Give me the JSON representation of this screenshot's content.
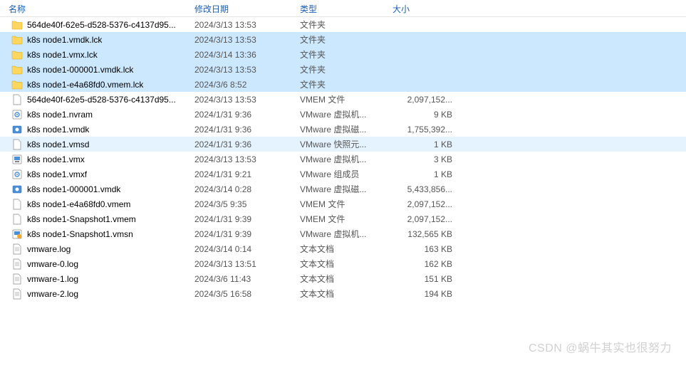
{
  "columns": {
    "name": "名称",
    "date": "修改日期",
    "type": "类型",
    "size": "大小"
  },
  "files": [
    {
      "icon": "folder",
      "name": "564de40f-62e5-d528-5376-c4137d95...",
      "date": "2024/3/13 13:53",
      "type": "文件夹",
      "size": "",
      "highlight": false
    },
    {
      "icon": "folder",
      "name": "k8s node1.vmdk.lck",
      "date": "2024/3/13 13:53",
      "type": "文件夹",
      "size": "",
      "highlight": true
    },
    {
      "icon": "folder",
      "name": "k8s node1.vmx.lck",
      "date": "2024/3/14 13:36",
      "type": "文件夹",
      "size": "",
      "highlight": true
    },
    {
      "icon": "folder",
      "name": "k8s node1-000001.vmdk.lck",
      "date": "2024/3/13 13:53",
      "type": "文件夹",
      "size": "",
      "highlight": true
    },
    {
      "icon": "folder",
      "name": "k8s node1-e4a68fd0.vmem.lck",
      "date": "2024/3/6 8:52",
      "type": "文件夹",
      "size": "",
      "highlight": true
    },
    {
      "icon": "file",
      "name": "564de40f-62e5-d528-5376-c4137d95...",
      "date": "2024/3/13 13:53",
      "type": "VMEM 文件",
      "size": "2,097,152...",
      "highlight": false
    },
    {
      "icon": "gear",
      "name": "k8s node1.nvram",
      "date": "2024/1/31 9:36",
      "type": "VMware 虚拟机...",
      "size": "9 KB",
      "highlight": false
    },
    {
      "icon": "disk",
      "name": "k8s node1.vmdk",
      "date": "2024/1/31 9:36",
      "type": "VMware 虚拟磁...",
      "size": "1,755,392...",
      "highlight": false
    },
    {
      "icon": "file",
      "name": "k8s node1.vmsd",
      "date": "2024/1/31 9:36",
      "type": "VMware 快照元...",
      "size": "1 KB",
      "highlight": false,
      "hover": true
    },
    {
      "icon": "vmx",
      "name": "k8s node1.vmx",
      "date": "2024/3/13 13:53",
      "type": "VMware 虚拟机...",
      "size": "3 KB",
      "highlight": false
    },
    {
      "icon": "gear",
      "name": "k8s node1.vmxf",
      "date": "2024/1/31 9:21",
      "type": "VMware 组成员",
      "size": "1 KB",
      "highlight": false
    },
    {
      "icon": "disk",
      "name": "k8s node1-000001.vmdk",
      "date": "2024/3/14 0:28",
      "type": "VMware 虚拟磁...",
      "size": "5,433,856...",
      "highlight": false
    },
    {
      "icon": "file",
      "name": "k8s node1-e4a68fd0.vmem",
      "date": "2024/3/5 9:35",
      "type": "VMEM 文件",
      "size": "2,097,152...",
      "highlight": false
    },
    {
      "icon": "file",
      "name": "k8s node1-Snapshot1.vmem",
      "date": "2024/1/31 9:39",
      "type": "VMEM 文件",
      "size": "2,097,152...",
      "highlight": false
    },
    {
      "icon": "snap",
      "name": "k8s node1-Snapshot1.vmsn",
      "date": "2024/1/31 9:39",
      "type": "VMware 虚拟机...",
      "size": "132,565 KB",
      "highlight": false
    },
    {
      "icon": "text",
      "name": "vmware.log",
      "date": "2024/3/14 0:14",
      "type": "文本文档",
      "size": "163 KB",
      "highlight": false
    },
    {
      "icon": "text",
      "name": "vmware-0.log",
      "date": "2024/3/13 13:51",
      "type": "文本文档",
      "size": "162 KB",
      "highlight": false
    },
    {
      "icon": "text",
      "name": "vmware-1.log",
      "date": "2024/3/6 11:43",
      "type": "文本文档",
      "size": "151 KB",
      "highlight": false
    },
    {
      "icon": "text",
      "name": "vmware-2.log",
      "date": "2024/3/5 16:58",
      "type": "文本文档",
      "size": "194 KB",
      "highlight": false
    }
  ],
  "watermark": "CSDN @蜗牛其实也很努力"
}
